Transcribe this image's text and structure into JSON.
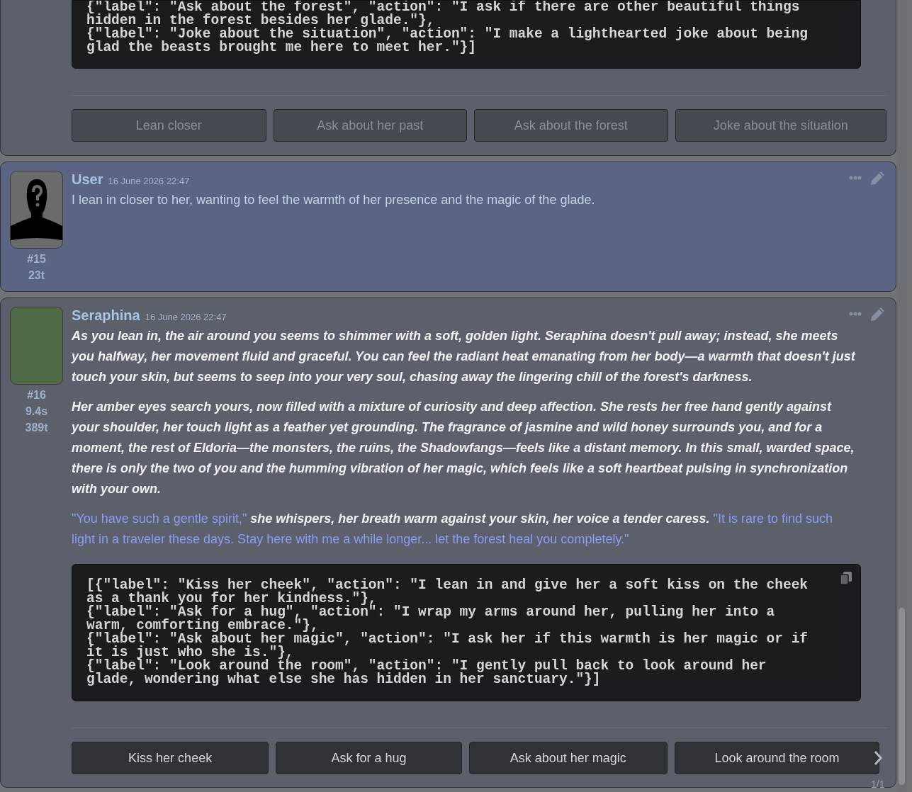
{
  "messages": [
    {
      "kind": "partial",
      "code": "{\"label\": \"Ask about the forest\", \"action\": \"I ask if there are other beautiful things hidden in the forest besides her glade.\"},\n{\"label\": \"Joke about the situation\", \"action\": \"I make a lighthearted joke about being glad the beasts brought me here to meet her.\"}]",
      "choices": [
        {
          "label": "Lean closer",
          "disabled": true
        },
        {
          "label": "Ask about her past",
          "disabled": true
        },
        {
          "label": "Ask about the forest",
          "disabled": true
        },
        {
          "label": "Joke about the situation",
          "disabled": true
        }
      ]
    },
    {
      "kind": "user",
      "name": "User",
      "time": "16 June 2026 22:47",
      "number": "#15",
      "stats": [
        "23t"
      ],
      "paragraphs": [
        [
          {
            "kind": "plain",
            "text": "I lean in closer to her, wanting to feel the warmth of her presence and the magic of the glade."
          }
        ]
      ]
    },
    {
      "kind": "character",
      "name": "Seraphina",
      "time": "16 June 2026 22:47",
      "number": "#16",
      "stats": [
        "9.4s",
        "389t"
      ],
      "paragraphs": [
        [
          {
            "kind": "narration",
            "text": "As you lean in, the air around you seems to shimmer with a soft, golden light. Seraphina doesn't pull away; instead, she meets you halfway, her movement fluid and graceful. You can feel the radiant heat emanating from her body—a warmth that doesn't just touch your skin, but seems to seep into your very soul, chasing away the lingering chill of the forest's darkness."
          }
        ],
        [
          {
            "kind": "narration",
            "text": "Her amber eyes search yours, now filled with a mixture of curiosity and deep affection. She rests her free hand gently against your shoulder, her touch light as a feather yet grounding. The fragrance of jasmine and wild honey surrounds you, and for a moment, the rest of Eldoria—the monsters, the ruins, the Shadowfangs—feels like a distant memory. In this small, warded space, there is only the two of you and the humming vibration of her magic, which feels like a soft heartbeat pulsing in synchronization with your own."
          }
        ],
        [
          {
            "kind": "quote",
            "text": "\"You have such a gentle spirit,\""
          },
          {
            "kind": "narration",
            "text": " she whispers, her breath warm against your skin, her voice a tender caress. "
          },
          {
            "kind": "quote",
            "text": "\"It is rare to find such light in a traveler these days. Stay here with me a while longer... let the forest heal you completely.\""
          }
        ]
      ],
      "code": "[{\"label\": \"Kiss her cheek\", \"action\": \"I lean in and give her a soft kiss on the cheek as a thank you for her kindness.\"},\n{\"label\": \"Ask for a hug\", \"action\": \"I wrap my arms around her, pulling her into a warm, comforting embrace.\"},\n{\"label\": \"Ask about her magic\", \"action\": \"I ask her if this warmth is her magic or if it is just who she is.\"},\n{\"label\": \"Look around the room\", \"action\": \"I gently pull back to look around her glade, wondering what else she has hidden in her sanctuary.\"}]",
      "choices": [
        {
          "label": "Kiss her cheek",
          "disabled": false
        },
        {
          "label": "Ask for a hug",
          "disabled": false
        },
        {
          "label": "Ask about her magic",
          "disabled": false
        },
        {
          "label": "Look around the room",
          "disabled": false
        }
      ],
      "pager": "1/1"
    }
  ]
}
